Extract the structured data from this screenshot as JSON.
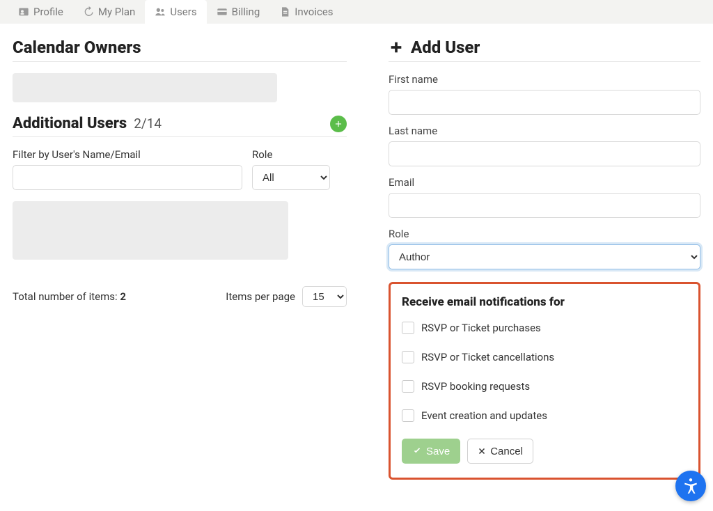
{
  "tabs": {
    "profile": "Profile",
    "myplan": "My Plan",
    "users": "Users",
    "billing": "Billing",
    "invoices": "Invoices",
    "active": "users"
  },
  "left": {
    "owners_title": "Calendar Owners",
    "addl_title": "Additional Users",
    "addl_count": "2/14",
    "filter_name_label": "Filter by User's Name/Email",
    "filter_role_label": "Role",
    "role_selected": "All",
    "total_label": "Total number of items: ",
    "total_count": "2",
    "items_pp_label": "Items per page",
    "items_pp_value": "15"
  },
  "right": {
    "title": "Add User",
    "first_name_label": "First name",
    "last_name_label": "Last name",
    "email_label": "Email",
    "role_label": "Role",
    "role_selected": "Author",
    "notif_title": "Receive email notifications for",
    "notif_options": {
      "opt1": "RSVP or Ticket purchases",
      "opt2": "RSVP or Ticket cancellations",
      "opt3": "RSVP booking requests",
      "opt4": "Event creation and updates"
    },
    "save_label": "Save",
    "cancel_label": "Cancel"
  }
}
